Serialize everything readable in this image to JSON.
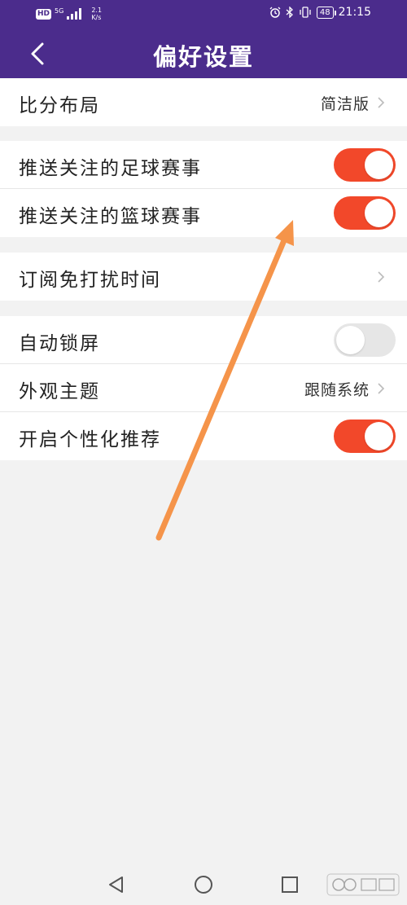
{
  "status_bar": {
    "hd_badge": "HD",
    "network_type": "5G",
    "speed_value": "2.1",
    "speed_unit": "K/s",
    "battery": "48",
    "time": "21:15"
  },
  "header": {
    "title": "偏好设置"
  },
  "groups": [
    {
      "rows": [
        {
          "label": "比分布局",
          "value": "简洁版",
          "control": "chevron"
        }
      ]
    },
    {
      "rows": [
        {
          "label": "推送关注的足球赛事",
          "control": "toggle",
          "state": "on"
        },
        {
          "label": "推送关注的篮球赛事",
          "control": "toggle",
          "state": "on"
        }
      ]
    },
    {
      "rows": [
        {
          "label": "订阅免打扰时间",
          "control": "chevron"
        }
      ]
    },
    {
      "rows": [
        {
          "label": "自动锁屏",
          "control": "toggle",
          "state": "off"
        },
        {
          "label": "外观主题",
          "value": "跟随系统",
          "control": "chevron"
        },
        {
          "label": "开启个性化推荐",
          "control": "toggle",
          "state": "on"
        }
      ]
    }
  ],
  "colors": {
    "header_bg": "#4b2c8c",
    "toggle_on": "#f2482a",
    "toggle_off": "#e6e6e6",
    "annotation_arrow": "#f5944a"
  },
  "icons": {
    "back": "chevron-left-icon",
    "row_arrow": "chevron-right-icon",
    "nav_back": "triangle-back-icon",
    "nav_home": "circle-home-icon",
    "nav_recent": "square-recent-icon"
  }
}
